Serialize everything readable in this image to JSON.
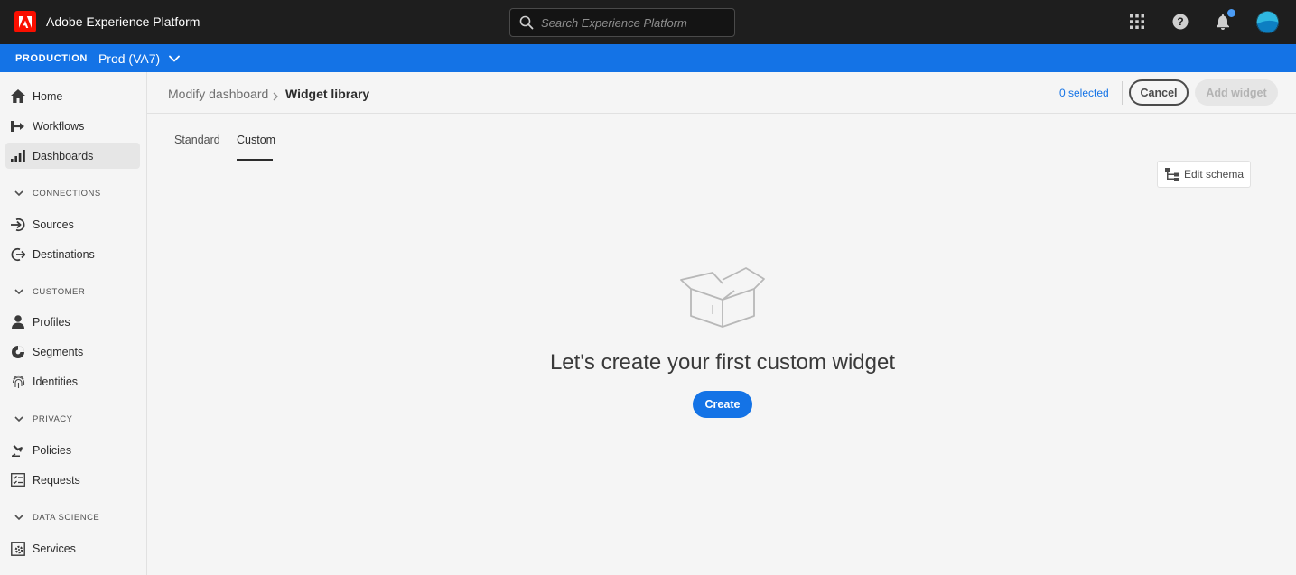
{
  "topbar": {
    "app_name": "Adobe Experience Platform",
    "search_placeholder": "Search Experience Platform",
    "icons": [
      "apps-grid-icon",
      "help-icon",
      "notifications-bell-icon",
      "user-avatar"
    ],
    "notification_dot_color": "#4b9cf5"
  },
  "environment": {
    "label": "PRODUCTION",
    "sandbox": "Prod (VA7)",
    "bar_color": "#1473e6"
  },
  "sidebar": {
    "items": [
      {
        "label": "Home",
        "icon": "home-icon"
      },
      {
        "label": "Workflows",
        "icon": "workflows-icon"
      },
      {
        "label": "Dashboards",
        "icon": "dashboards-icon",
        "active": true
      },
      {
        "section": "CONNECTIONS"
      },
      {
        "label": "Sources",
        "icon": "sources-icon"
      },
      {
        "label": "Destinations",
        "icon": "destinations-icon"
      },
      {
        "section": "CUSTOMER"
      },
      {
        "label": "Profiles",
        "icon": "profiles-icon"
      },
      {
        "label": "Segments",
        "icon": "segments-icon"
      },
      {
        "label": "Identities",
        "icon": "identities-icon"
      },
      {
        "section": "PRIVACY"
      },
      {
        "label": "Policies",
        "icon": "policies-icon"
      },
      {
        "label": "Requests",
        "icon": "requests-icon"
      },
      {
        "section": "DATA SCIENCE"
      },
      {
        "label": "Services",
        "icon": "services-icon"
      }
    ]
  },
  "header": {
    "breadcrumb_parent": "Modify dashboard",
    "breadcrumb_current": "Widget library",
    "selected_count": "0 selected",
    "cancel_label": "Cancel",
    "add_widget_label": "Add widget"
  },
  "tabs": {
    "standard": "Standard",
    "custom": "Custom",
    "active": "Custom"
  },
  "toolbar": {
    "edit_schema_label": "Edit schema"
  },
  "empty_state": {
    "illustration": "open-box-icon",
    "title": "Let's create your first custom widget",
    "create_label": "Create"
  },
  "colors": {
    "accent": "#1473e6",
    "topbar": "#1e1e1e",
    "brand": "#fa0f00"
  }
}
